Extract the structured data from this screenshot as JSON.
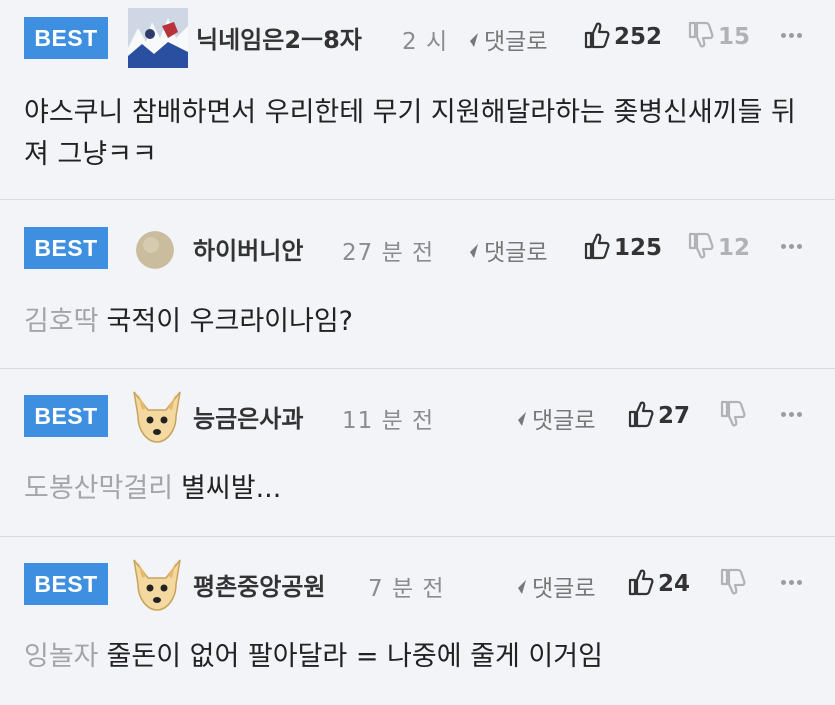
{
  "badge_label": "BEST",
  "reply_label": "댓글로",
  "comments": [
    {
      "nickname": "닉네임은2ㅡ8자",
      "time": "2 시",
      "likes": "252",
      "dislikes": "15",
      "mention": "",
      "text": "야스쿠니 참배하면서 우리한테 무기 지원해달라하는 좆병신새끼들 뒤져 그냥ㅋㅋ"
    },
    {
      "nickname": "하이버니안",
      "time": "27 분 전",
      "likes": "125",
      "dislikes": "12",
      "mention": "김호딱",
      "text": "국적이 우크라이나임?"
    },
    {
      "nickname": "능금은사과",
      "time": "11 분 전",
      "likes": "27",
      "dislikes": "",
      "mention": "도봉산막걸리",
      "text": "별씨발..."
    },
    {
      "nickname": "평촌중앙공원",
      "time": "7 분 전",
      "likes": "24",
      "dislikes": "",
      "mention": "잉놀자",
      "text": "줄돈이 없어 팔아달라 = 나중에 줄게 이거임"
    }
  ]
}
